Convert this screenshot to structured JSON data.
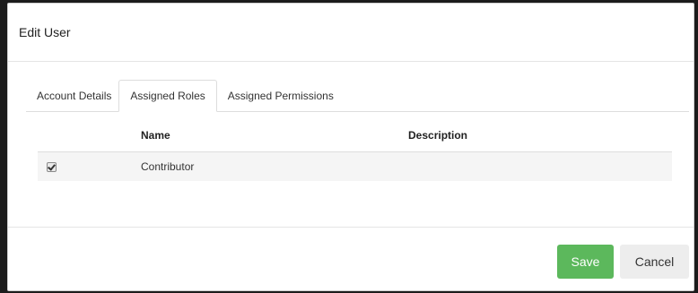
{
  "dialog": {
    "title": "Edit User"
  },
  "tabs": [
    {
      "label": "Account Details",
      "active": false
    },
    {
      "label": "Assigned Roles",
      "active": true
    },
    {
      "label": "Assigned Permissions",
      "active": false
    }
  ],
  "roles_table": {
    "columns": [
      "",
      "Name",
      "Description"
    ],
    "rows": [
      {
        "checked": true,
        "name": "Contributor",
        "description": ""
      }
    ]
  },
  "footer": {
    "save_label": "Save",
    "cancel_label": "Cancel"
  },
  "colors": {
    "save_button": "#5cb85c",
    "cancel_button": "#ededed",
    "row_background": "#f5f5f5"
  }
}
